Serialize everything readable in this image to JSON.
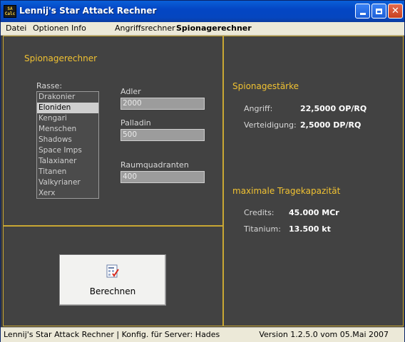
{
  "window": {
    "title": "Lennij's Star Attack Rechner",
    "icon_text": "SA\nCalc"
  },
  "menu": {
    "datei": "Datei",
    "optionen": "Optionen",
    "info": "Info",
    "tab_angriff": "Angriffsrechner",
    "tab_spionage": "Spionagerechner"
  },
  "left": {
    "section_title": "Spionagerechner",
    "rasse_label": "Rasse:",
    "races": [
      "Drakonier",
      "Eloniden",
      "Kengari",
      "Menschen",
      "Shadows",
      "Space Imps",
      "Talaxianer",
      "Titanen",
      "Valkyrianer",
      "Xerx"
    ],
    "selected_race": "Eloniden",
    "adler_label": "Adler",
    "adler_value": "2000",
    "palladin_label": "Palladin",
    "palladin_value": "500",
    "raumquadranten_label": "Raumquadranten",
    "raumquadranten_value": "400",
    "button_label": "Berechnen",
    "button_icon": "calculator-icon"
  },
  "right": {
    "spionage_title": "Spionagestärke",
    "angriff_label": "Angriff:",
    "angriff_value": "22,5000 OP/RQ",
    "verteidigung_label": "Verteidigung:",
    "verteidigung_value": "2,5000 DP/RQ",
    "trage_title": "maximale Tragekapazität",
    "credits_label": "Credits:",
    "credits_value": "45.000 MCr",
    "titanium_label": "Titanium:",
    "titanium_value": "13.500 kt"
  },
  "status": {
    "left": "Lennij's Star Attack Rechner | Konfig. für Server: Hades",
    "right": "Version 1.2.5.0 vom 05.Mai 2007"
  },
  "colors": {
    "accent": "#f1c232",
    "panel_bg": "#424242",
    "titlebar": "#0546bf"
  }
}
